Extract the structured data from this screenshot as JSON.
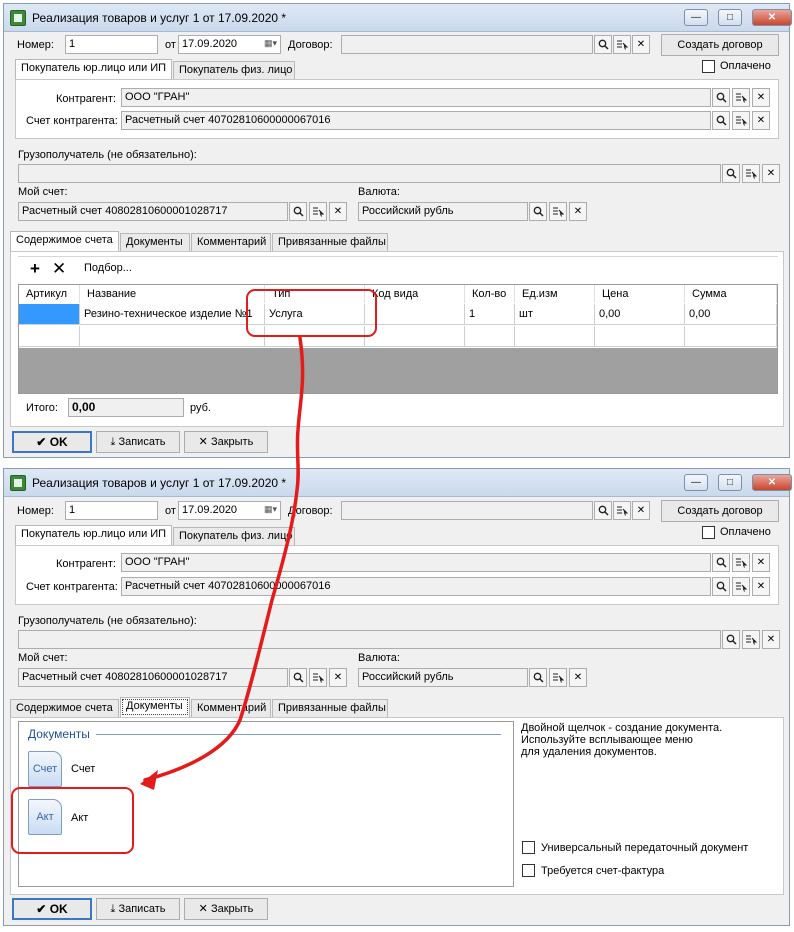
{
  "win1": {
    "title": "Реализация товаров и услуг 1 от 17.09.2020 *",
    "number_label": "Номер:",
    "number_value": "1",
    "from_label": "от",
    "date_value": "17.09.2020",
    "contract_label": "Договор:",
    "contract_value": "",
    "create_contract_label": "Создать договор",
    "paid_label": "Оплачено",
    "buyer_tabs": [
      "Покупатель юр.лицо или ИП",
      "Покупатель физ. лицо"
    ],
    "counterparty_label": "Контрагент:",
    "counterparty_value": "ООО \"ГРАН\"",
    "cp_account_label": "Счет контрагента:",
    "cp_account_value": "Расчетный счет 40702810600000067016",
    "consignee_label": "Грузополучатель (не обязательно):",
    "consignee_value": "",
    "my_account_label": "Мой счет:",
    "my_account_value": "Расчетный счет 40802810600001028717",
    "currency_label": "Валюта:",
    "currency_value": "Российский рубль",
    "tabs": [
      "Содержимое счета",
      "Документы",
      "Комментарий",
      "Привязанные файлы"
    ],
    "toolbar": {
      "add_icon": "plus-icon",
      "delete_icon": "x-icon",
      "pick_label": "Подбор..."
    },
    "table": {
      "columns": [
        "Артикул",
        "Название",
        "Тип",
        "Код вида",
        "Кол-во",
        "Ед.изм",
        "Цена",
        "Сумма"
      ],
      "rows": [
        [
          "",
          "Резино-техническое изделие №1",
          "Услуга",
          "",
          "1",
          "шт",
          "0,00",
          "0,00"
        ],
        [
          "",
          "",
          "",
          "",
          "",
          "",
          "",
          ""
        ]
      ]
    },
    "total_label": "Итого:",
    "total_value": "0,00",
    "currency_short": "руб.",
    "ok_label": "OK",
    "save_label": "Записать",
    "close_label": "Закрыть"
  },
  "win2": {
    "title": "Реализация товаров и услуг 1 от 17.09.2020 *",
    "number_label": "Номер:",
    "number_value": "1",
    "from_label": "от",
    "date_value": "17.09.2020",
    "contract_label": "Договор:",
    "contract_value": "",
    "create_contract_label": "Создать договор",
    "paid_label": "Оплачено",
    "buyer_tabs": [
      "Покупатель юр.лицо или ИП",
      "Покупатель физ. лицо"
    ],
    "counterparty_label": "Контрагент:",
    "counterparty_value": "ООО \"ГРАН\"",
    "cp_account_label": "Счет контрагента:",
    "cp_account_value": "Расчетный счет 40702810600000067016",
    "consignee_label": "Грузополучатель (не обязательно):",
    "consignee_value": "",
    "my_account_label": "Мой счет:",
    "my_account_value": "Расчетный счет 40802810600001028717",
    "currency_label": "Валюта:",
    "currency_value": "Российский рубль",
    "tabs": [
      "Содержимое счета",
      "Документы",
      "Комментарий",
      "Привязанные файлы"
    ],
    "documents_group_label": "Документы",
    "documents": [
      {
        "icon_text": "Счет",
        "label": "Счет"
      },
      {
        "icon_text": "Акт",
        "label": "Акт"
      }
    ],
    "hint_lines": [
      "Двойной щелчок - создание документа.",
      "Используйте всплывающее меню",
      "для удаления документов."
    ],
    "upd_label": "Универсальный передаточный документ",
    "invoice_required_label": "Требуется счет-фактура",
    "ok_label": "OK",
    "save_label": "Записать",
    "close_label": "Закрыть"
  },
  "annotation": {
    "color": "#e41b1b"
  }
}
